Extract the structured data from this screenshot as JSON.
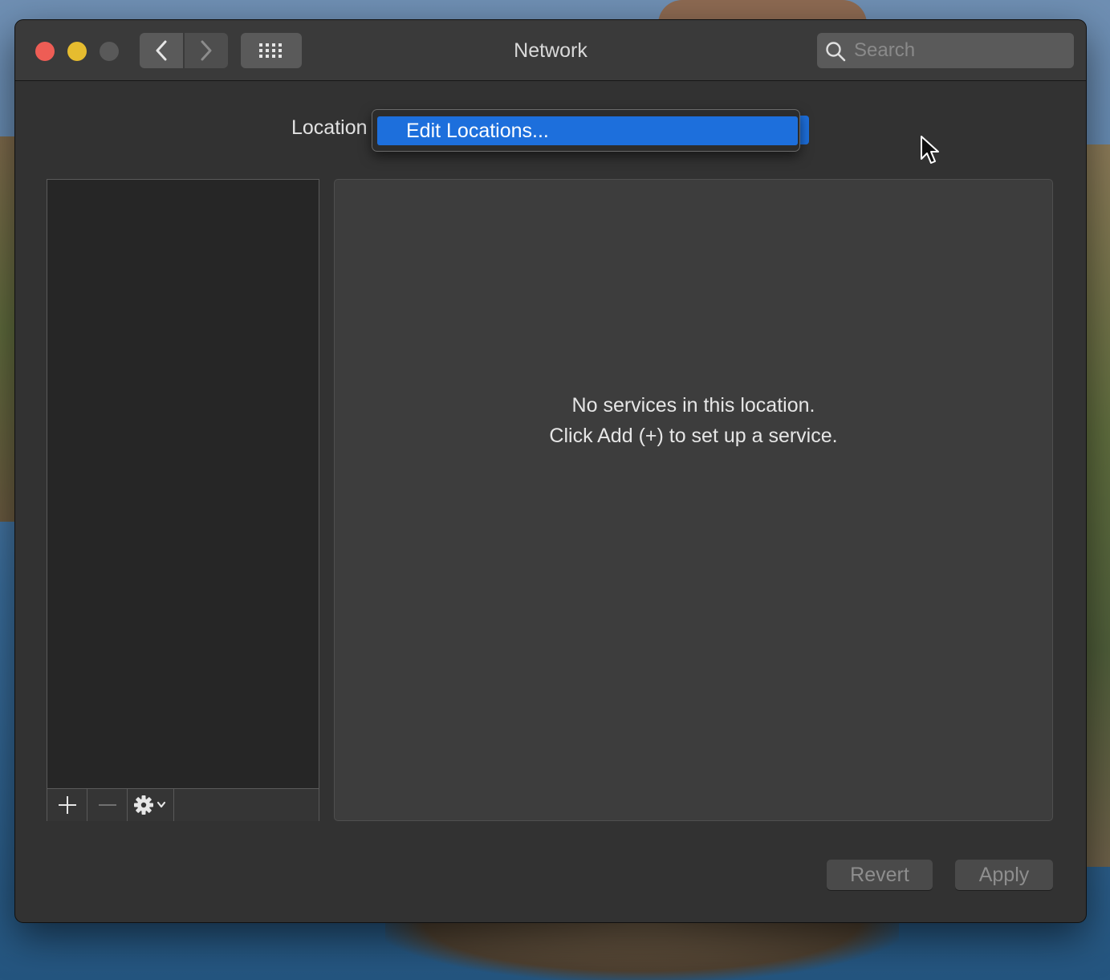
{
  "window": {
    "title": "Network"
  },
  "toolbar": {
    "back_icon": "chevron-left-icon",
    "forward_icon": "chevron-right-icon",
    "grid_icon": "show-all-grid-icon"
  },
  "search": {
    "placeholder": "Search",
    "value": ""
  },
  "location": {
    "label": "Location",
    "menu_item_selected": "Edit Locations..."
  },
  "service_list": {
    "add_icon": "plus-icon",
    "remove_icon": "minus-icon",
    "action_icon": "gear-menu-icon"
  },
  "details": {
    "empty_line1": "No services in this location.",
    "empty_line2": "Click Add (+) to set up a service."
  },
  "buttons": {
    "revert": "Revert",
    "apply": "Apply"
  },
  "colors": {
    "selection_accent": "#1d6fdc",
    "close": "#ee5d55",
    "minimize": "#e6bc2f",
    "zoom_disabled": "#595959"
  }
}
